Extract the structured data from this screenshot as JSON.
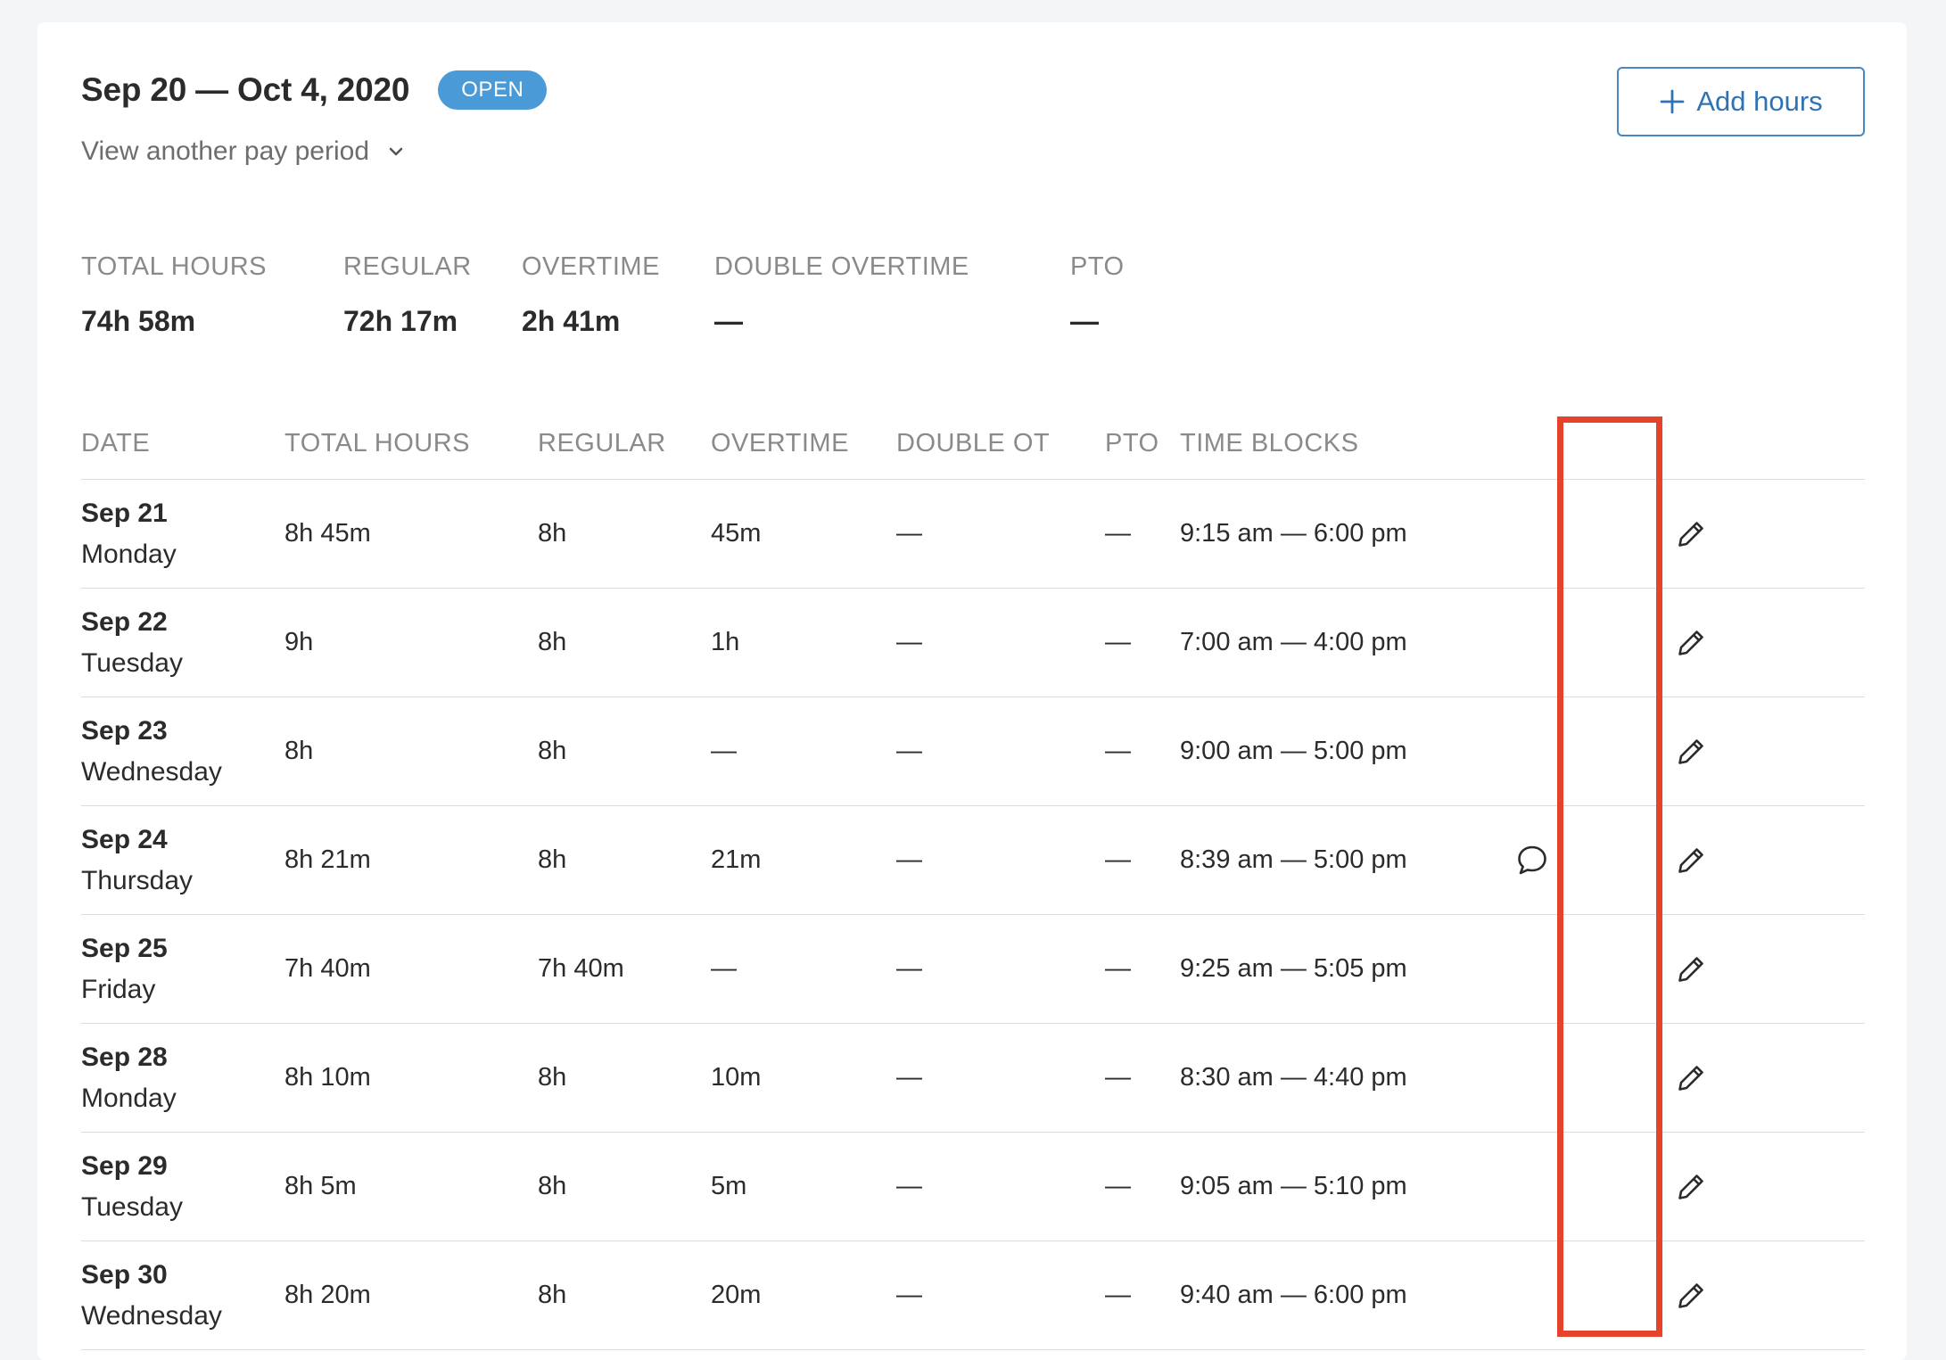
{
  "header": {
    "period_title": "Sep 20 — Oct 4, 2020",
    "status_badge": "OPEN",
    "view_other_link": "View another pay period",
    "add_hours_label": "Add hours"
  },
  "summary": [
    {
      "label": "TOTAL HOURS",
      "value": "74h 58m"
    },
    {
      "label": "REGULAR",
      "value": "72h 17m"
    },
    {
      "label": "OVERTIME",
      "value": "2h 41m"
    },
    {
      "label": "DOUBLE OVERTIME",
      "value": "—"
    },
    {
      "label": "PTO",
      "value": "—"
    }
  ],
  "table": {
    "columns": [
      "DATE",
      "TOTAL HOURS",
      "REGULAR",
      "OVERTIME",
      "DOUBLE OT",
      "PTO",
      "TIME BLOCKS"
    ],
    "rows": [
      {
        "date": "Sep 21",
        "day": "Monday",
        "total": "8h 45m",
        "regular": "8h",
        "overtime": "45m",
        "double_ot": "—",
        "pto": "—",
        "time_blocks": "9:15 am — 6:00 pm",
        "has_comment": false
      },
      {
        "date": "Sep 22",
        "day": "Tuesday",
        "total": "9h",
        "regular": "8h",
        "overtime": "1h",
        "double_ot": "—",
        "pto": "—",
        "time_blocks": "7:00 am — 4:00 pm",
        "has_comment": false
      },
      {
        "date": "Sep 23",
        "day": "Wednesday",
        "total": "8h",
        "regular": "8h",
        "overtime": "—",
        "double_ot": "—",
        "pto": "—",
        "time_blocks": "9:00 am — 5:00 pm",
        "has_comment": false
      },
      {
        "date": "Sep 24",
        "day": "Thursday",
        "total": "8h 21m",
        "regular": "8h",
        "overtime": "21m",
        "double_ot": "—",
        "pto": "—",
        "time_blocks": "8:39 am — 5:00 pm",
        "has_comment": true
      },
      {
        "date": "Sep 25",
        "day": "Friday",
        "total": "7h 40m",
        "regular": "7h 40m",
        "overtime": "—",
        "double_ot": "—",
        "pto": "—",
        "time_blocks": "9:25 am — 5:05 pm",
        "has_comment": false
      },
      {
        "date": "Sep 28",
        "day": "Monday",
        "total": "8h 10m",
        "regular": "8h",
        "overtime": "10m",
        "double_ot": "—",
        "pto": "—",
        "time_blocks": "8:30 am — 4:40 pm",
        "has_comment": false
      },
      {
        "date": "Sep 29",
        "day": "Tuesday",
        "total": "8h 5m",
        "regular": "8h",
        "overtime": "5m",
        "double_ot": "—",
        "pto": "—",
        "time_blocks": "9:05 am — 5:10 pm",
        "has_comment": false
      },
      {
        "date": "Sep 30",
        "day": "Wednesday",
        "total": "8h 20m",
        "regular": "8h",
        "overtime": "20m",
        "double_ot": "—",
        "pto": "—",
        "time_blocks": "9:40 am — 6:00 pm",
        "has_comment": false
      }
    ]
  },
  "icons": {
    "edit": "pencil-icon",
    "comment": "comment-bubble-icon",
    "add": "plus-icon",
    "dropdown": "chevron-down-icon"
  },
  "colors": {
    "badge_bg": "#4a9ad8",
    "button_border": "#4a86c0",
    "button_text": "#2f73b5",
    "highlight": "#e6432d"
  }
}
